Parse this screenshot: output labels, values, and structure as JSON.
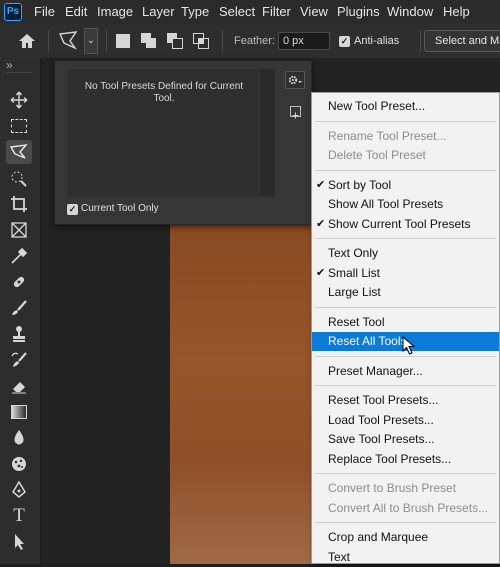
{
  "menubar": {
    "logo": "Ps",
    "items": [
      "File",
      "Edit",
      "Image",
      "Layer",
      "Type",
      "Select",
      "Filter",
      "View",
      "Plugins",
      "Window",
      "Help"
    ]
  },
  "options": {
    "feather_label": "Feather:",
    "feather_value": "0 px",
    "antialias_label": "Anti-alias",
    "antialias_checked": true,
    "select_mask_label": "Select and Mask..."
  },
  "toolbar": {
    "collapse_glyph": "»",
    "tools": [
      "move-tool",
      "marquee-tool",
      "polygonal-lasso-tool",
      "quick-selection-tool",
      "crop-tool",
      "frame-tool",
      "eyedropper-tool",
      "spot-healing-tool",
      "brush-tool",
      "clone-stamp-tool",
      "history-brush-tool",
      "eraser-tool",
      "gradient-tool",
      "blur-tool",
      "dodge-tool",
      "pen-tool",
      "type-tool",
      "path-selection-tool"
    ]
  },
  "presets_panel": {
    "empty_message": "No Tool Presets Defined for Current Tool.",
    "current_tool_only_label": "Current Tool Only",
    "current_tool_only_checked": true
  },
  "preset_menu": {
    "groups": [
      [
        {
          "label": "New Tool Preset...",
          "enabled": true,
          "checked": false,
          "highlighted": false
        }
      ],
      [
        {
          "label": "Rename Tool Preset...",
          "enabled": false,
          "checked": false,
          "highlighted": false
        },
        {
          "label": "Delete Tool Preset",
          "enabled": false,
          "checked": false,
          "highlighted": false
        }
      ],
      [
        {
          "label": "Sort by Tool",
          "enabled": true,
          "checked": true,
          "highlighted": false
        },
        {
          "label": "Show All Tool Presets",
          "enabled": true,
          "checked": false,
          "highlighted": false
        },
        {
          "label": "Show Current Tool Presets",
          "enabled": true,
          "checked": true,
          "highlighted": false
        }
      ],
      [
        {
          "label": "Text Only",
          "enabled": true,
          "checked": false,
          "highlighted": false
        },
        {
          "label": "Small List",
          "enabled": true,
          "checked": true,
          "highlighted": false
        },
        {
          "label": "Large List",
          "enabled": true,
          "checked": false,
          "highlighted": false
        }
      ],
      [
        {
          "label": "Reset Tool",
          "enabled": true,
          "checked": false,
          "highlighted": false
        },
        {
          "label": "Reset All Tools",
          "enabled": true,
          "checked": false,
          "highlighted": true
        }
      ],
      [
        {
          "label": "Preset Manager...",
          "enabled": true,
          "checked": false,
          "highlighted": false
        }
      ],
      [
        {
          "label": "Reset Tool Presets...",
          "enabled": true,
          "checked": false,
          "highlighted": false
        },
        {
          "label": "Load Tool Presets...",
          "enabled": true,
          "checked": false,
          "highlighted": false
        },
        {
          "label": "Save Tool Presets...",
          "enabled": true,
          "checked": false,
          "highlighted": false
        },
        {
          "label": "Replace Tool Presets...",
          "enabled": true,
          "checked": false,
          "highlighted": false
        }
      ],
      [
        {
          "label": "Convert to Brush Preset",
          "enabled": false,
          "checked": false,
          "highlighted": false
        },
        {
          "label": "Convert All to Brush Presets...",
          "enabled": false,
          "checked": false,
          "highlighted": false
        }
      ],
      [
        {
          "label": "Crop and Marquee",
          "enabled": true,
          "checked": false,
          "highlighted": false
        },
        {
          "label": "Text",
          "enabled": true,
          "checked": false,
          "highlighted": false
        }
      ]
    ]
  },
  "colors": {
    "highlight": "#0c7ad8",
    "menubar_bg": "#2b2b2b",
    "canvas_photo": "#8f4f26"
  }
}
